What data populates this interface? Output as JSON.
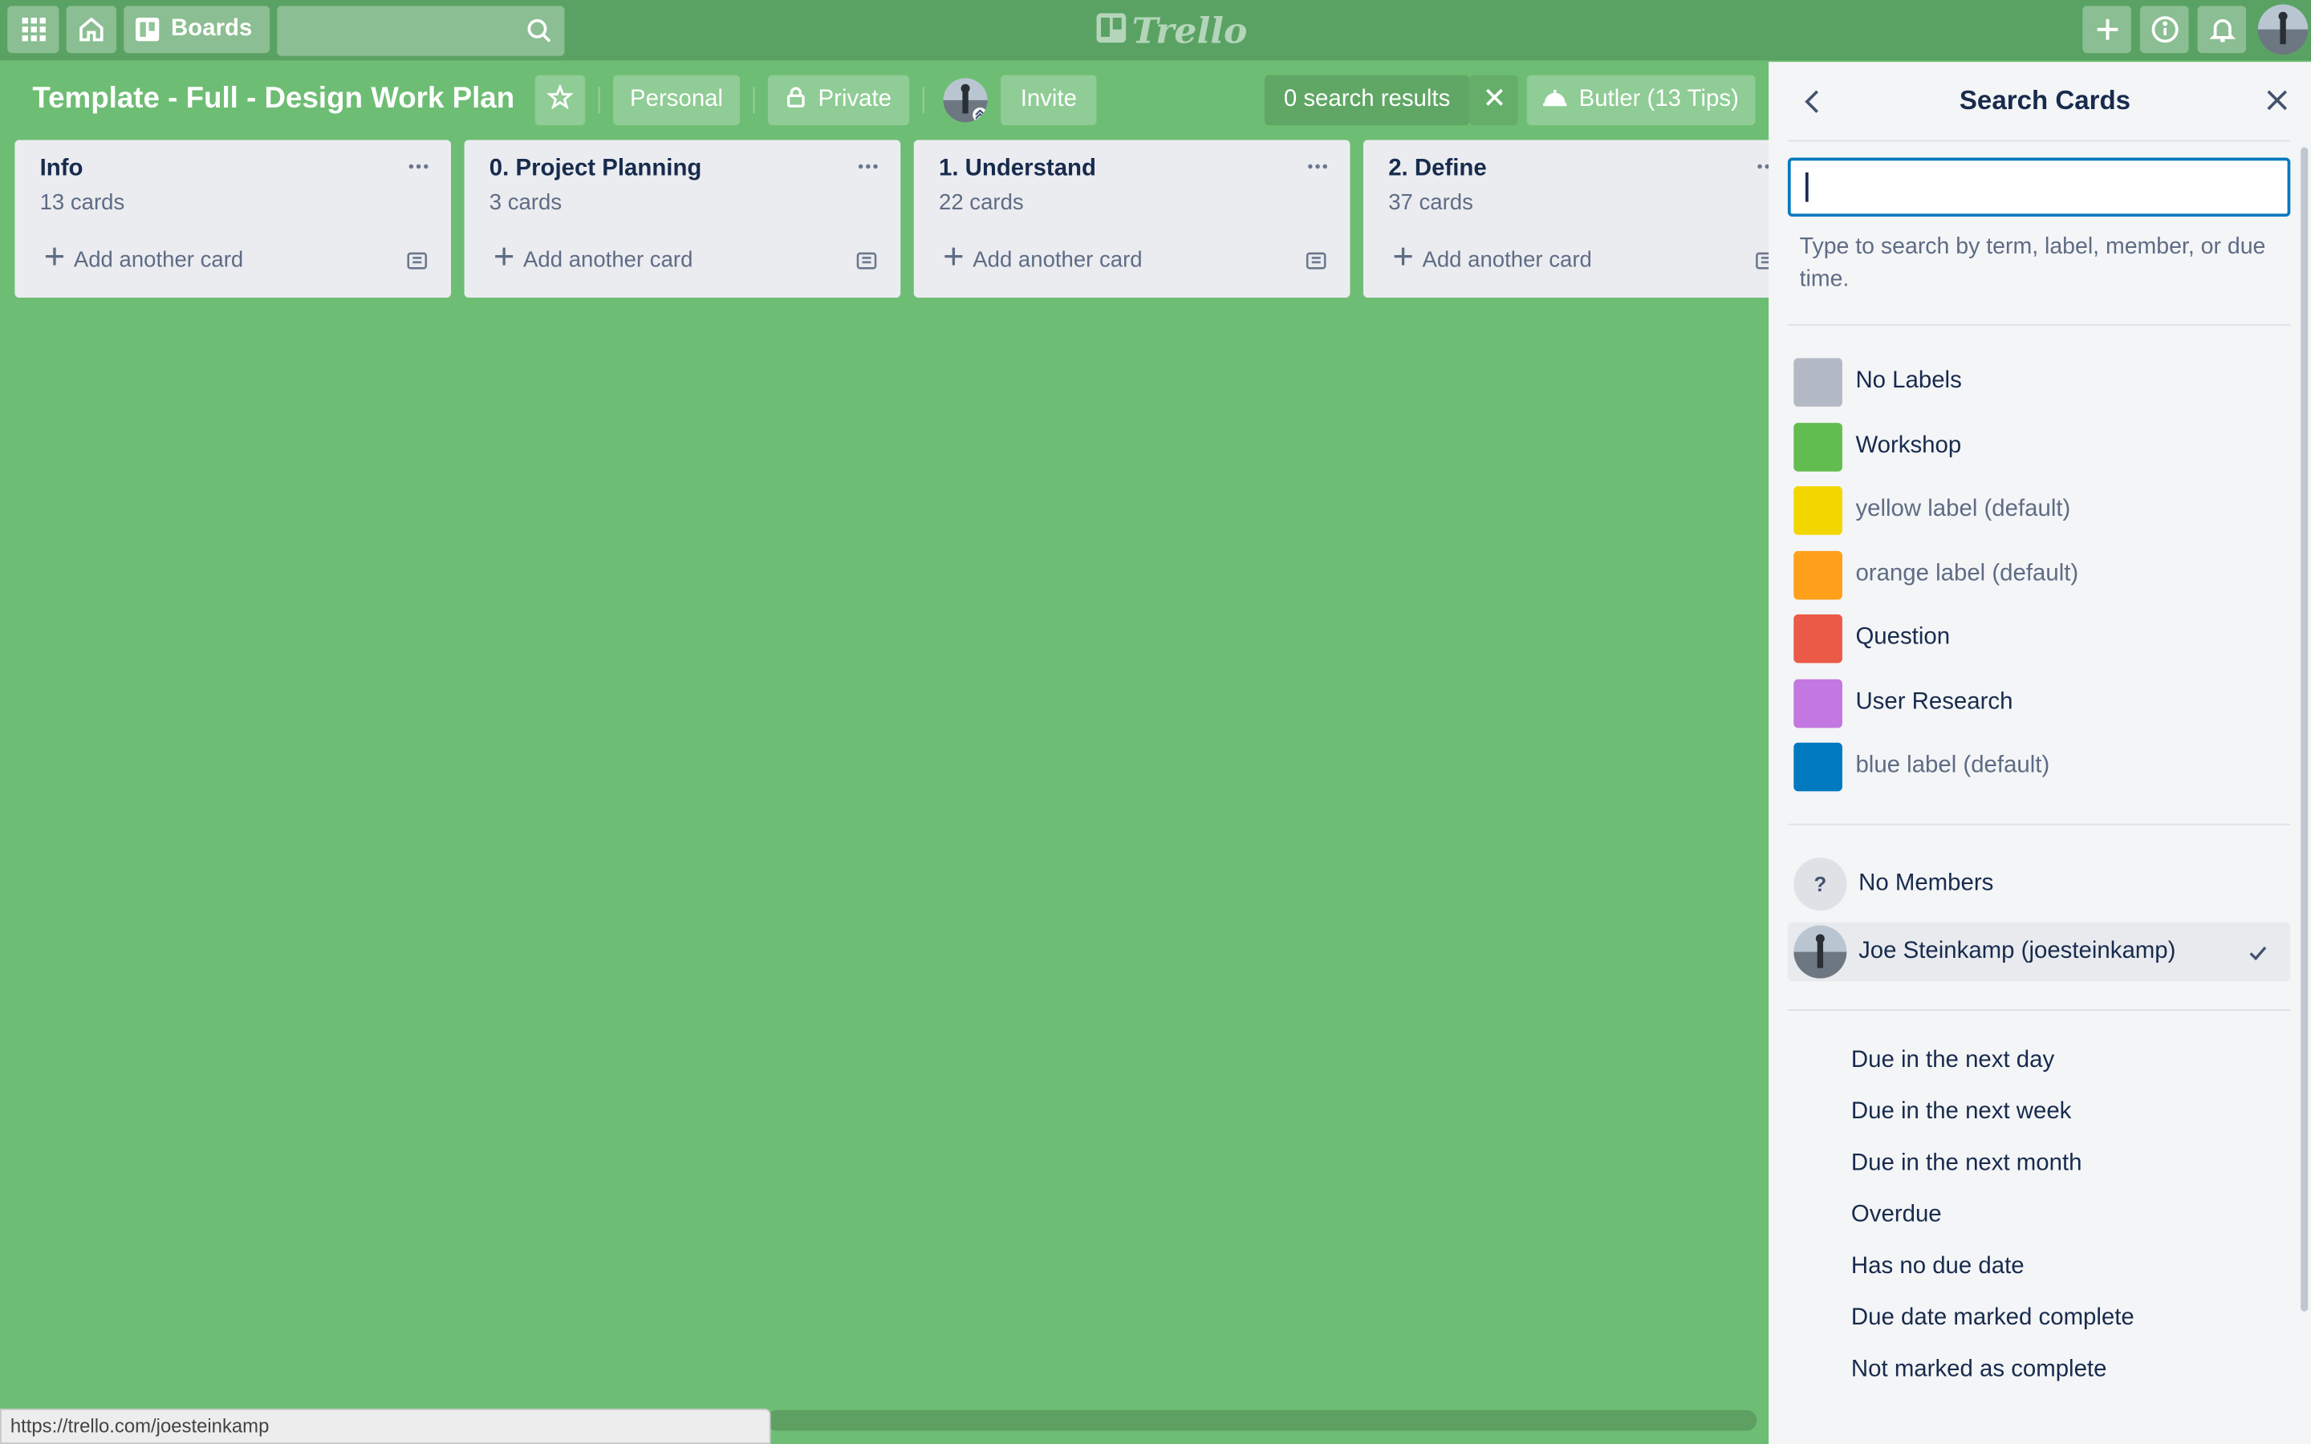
{
  "colors": {
    "board_bg": "#6ebd74",
    "header_bg": "#5aa264",
    "panel_bg": "#f4f5f7",
    "focus": "#0079bf"
  },
  "header": {
    "boards_label": "Boards",
    "logo_text": "Trello",
    "icons": [
      "apps-grid-icon",
      "home-icon",
      "boards-icon",
      "search-icon",
      "plus-icon",
      "info-icon",
      "bell-icon"
    ]
  },
  "board": {
    "title": "Template - Full - Design Work Plan",
    "team_label": "Personal",
    "visibility_label": "Private",
    "invite_label": "Invite",
    "search_results_label": "0 search results",
    "butler_label": "Butler (13 Tips)"
  },
  "lists": [
    {
      "name": "Info",
      "count": "13 cards",
      "add_label": "Add another card"
    },
    {
      "name": "0. Project Planning",
      "count": "3 cards",
      "add_label": "Add another card"
    },
    {
      "name": "1. Understand",
      "count": "22 cards",
      "add_label": "Add another card"
    },
    {
      "name": "2. Define",
      "count": "37 cards",
      "add_label": "Add another card"
    }
  ],
  "status_bar": {
    "url": "https://trello.com/joesteinkamp"
  },
  "panel": {
    "title": "Search Cards",
    "search": {
      "value": "",
      "help": "Type to search by term, label, member, or due time."
    },
    "labels": [
      {
        "name": "No Labels",
        "color": "#b3bac5"
      },
      {
        "name": "Workshop",
        "color": "#61bd4f"
      },
      {
        "name": "yellow label (default)",
        "color": "#f2d600"
      },
      {
        "name": "orange label (default)",
        "color": "#ff9f1a"
      },
      {
        "name": "Question",
        "color": "#eb5a46"
      },
      {
        "name": "User Research",
        "color": "#c377e0"
      },
      {
        "name": "blue label (default)",
        "color": "#0079bf"
      }
    ],
    "members": [
      {
        "name": "No Members",
        "initial": "?",
        "selected": false
      },
      {
        "name": "Joe Steinkamp (joesteinkamp)",
        "selected": true
      }
    ],
    "due": [
      "Due in the next day",
      "Due in the next week",
      "Due in the next month",
      "Overdue",
      "Has no due date",
      "Due date marked complete",
      "Not marked as complete"
    ]
  }
}
